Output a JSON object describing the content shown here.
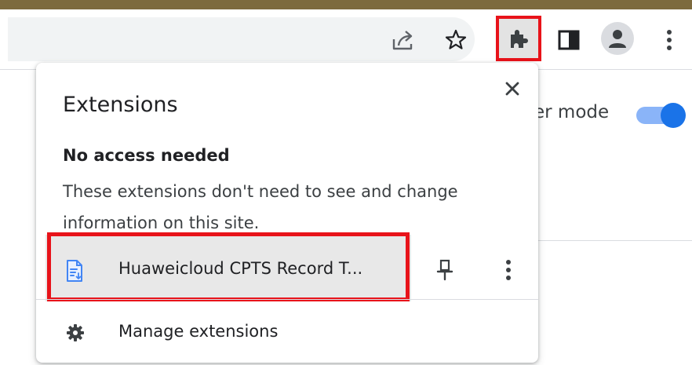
{
  "colors": {
    "highlight_border": "#e8131a",
    "accent": "#1a73e8",
    "window_strip": "#7d6a3e"
  },
  "toolbar": {
    "icons": [
      "share-icon",
      "bookmark-star-icon",
      "extensions-puzzle-icon",
      "side-panel-icon",
      "profile-avatar-icon",
      "more-menu-icon"
    ]
  },
  "page": {
    "partial_text": "er mode",
    "toggle_on": true
  },
  "extensions_popup": {
    "title": "Extensions",
    "section_title": "No access needed",
    "section_description": "These extensions don't need to see and change information on this site.",
    "extensions": [
      {
        "name": "Huaweicloud CPTS Record T...",
        "icon": "document-icon",
        "pinned": false
      }
    ],
    "manage_label": "Manage extensions"
  }
}
